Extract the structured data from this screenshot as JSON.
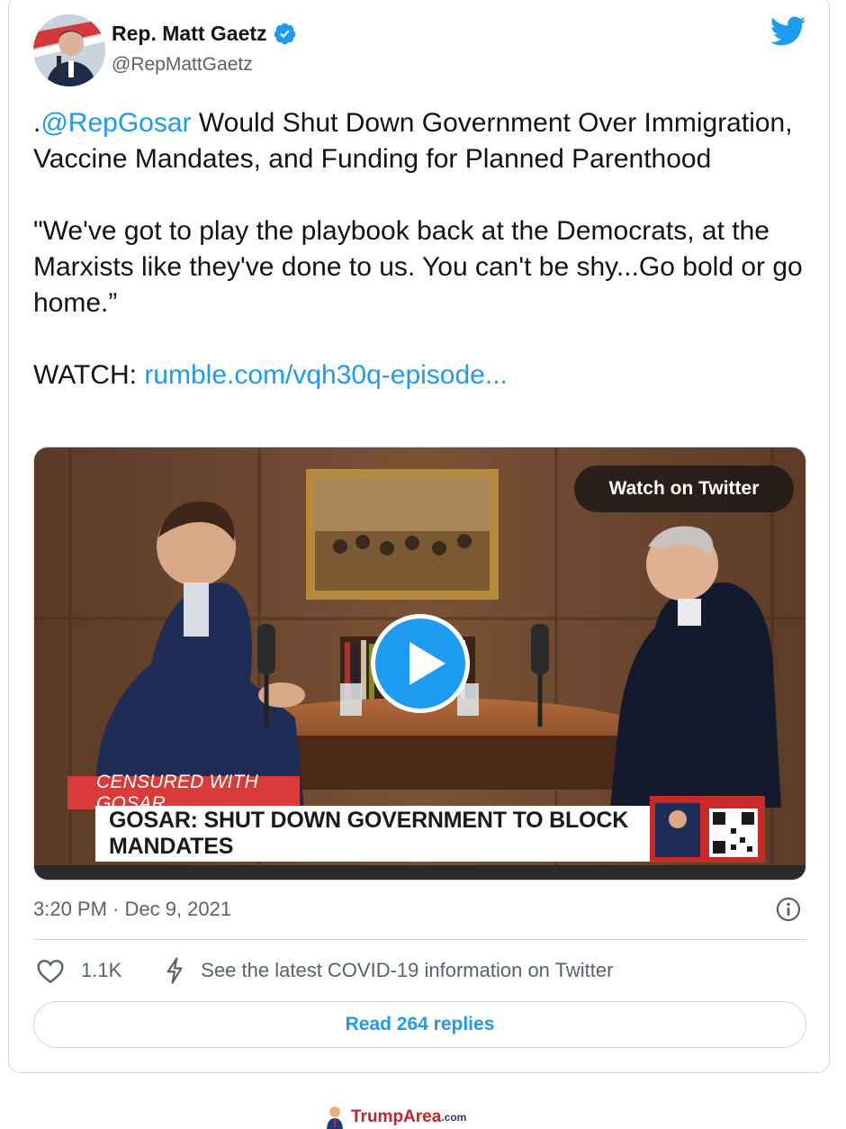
{
  "author": {
    "name": "Rep. Matt Gaetz",
    "handle": "@RepMattGaetz",
    "verified": true,
    "avatar_icon": "person-avatar"
  },
  "tweet": {
    "mention": "@RepGosar",
    "headline_prefix": ".",
    "headline_rest": " Would Shut Down Government Over Immigration, Vaccine Mandates, and Funding for Planned Parenthood",
    "quote": "\"We've got to play the playbook back at the Democrats, at the Marxists like they've done to us. You can't be shy...Go bold or go home.”",
    "watch_label": "WATCH: ",
    "watch_link": "rumble.com/vqh30q-episode..."
  },
  "media": {
    "watch_button": "Watch on Twitter",
    "lower_third_tag": "CENSURED WITH GOSAR",
    "lower_third_headline": "GOSAR: SHUT DOWN GOVERNMENT TO BLOCK MANDATES",
    "play_icon": "play-icon"
  },
  "meta": {
    "timestamp": "3:20 PM · Dec 9, 2021"
  },
  "actions": {
    "likes": "1.1K",
    "covid_info": "See the latest COVID-19 information on Twitter"
  },
  "replies_button": "Read 264 replies",
  "footer": {
    "brand": "TrumpArea",
    "tld": ".com"
  },
  "colors": {
    "accent": "#1d9bf0",
    "text": "#0f1419",
    "muted": "#536471",
    "border": "#cfd9de",
    "banner_red": "#d93a3a"
  }
}
